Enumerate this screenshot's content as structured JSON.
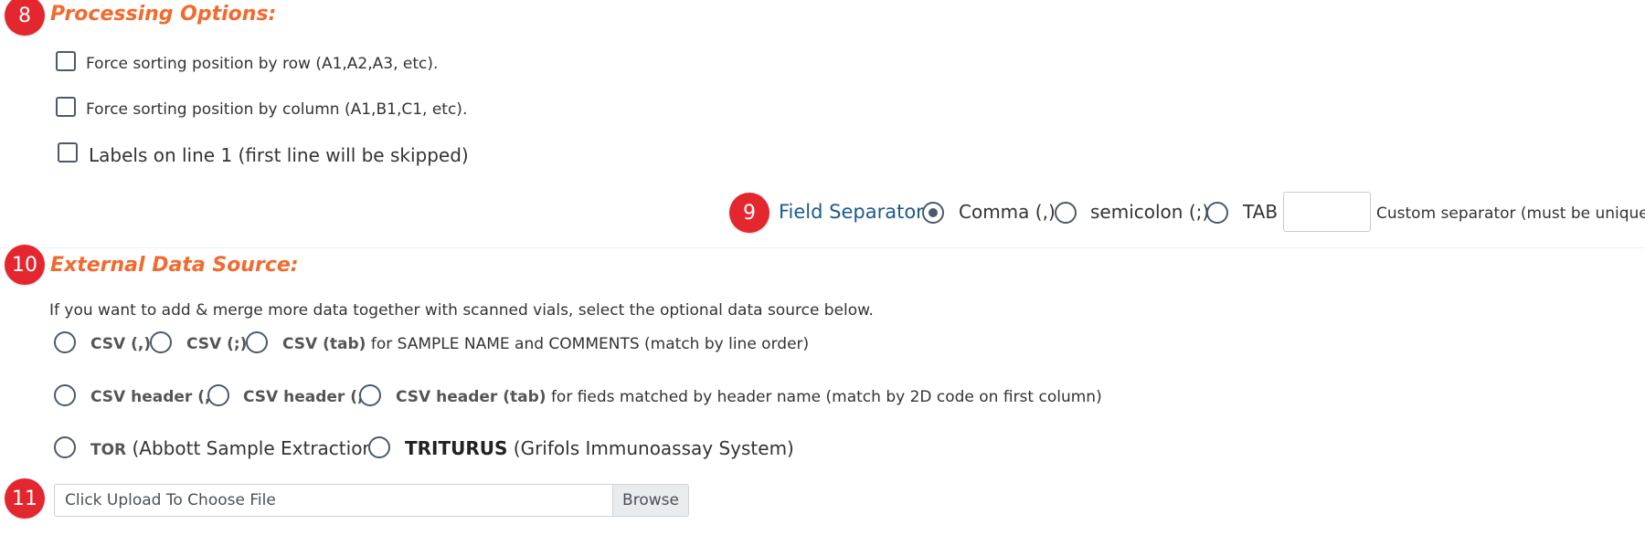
{
  "processing": {
    "badge": "8",
    "title": "Processing Options:",
    "options": [
      "Force sorting position by row (A1,A2,A3, etc).",
      "Force sorting position by column (A1,B1,C1, etc).",
      "Labels on line 1 (first line will be skipped)"
    ]
  },
  "separator": {
    "badge": "9",
    "label": "Field Separator:",
    "options": [
      "Comma (,)",
      "semicolon (;)",
      "TAB"
    ],
    "selected": "Comma (,)",
    "custom_value": "",
    "custom_hint": "Custom separator (must be unique)"
  },
  "external": {
    "badge": "10",
    "title": "External Data Source:",
    "description": "If you want to add & merge more data together with scanned vials, select the optional data source below.",
    "row1": {
      "options": [
        "CSV (,)",
        "CSV (;)",
        "CSV (tab)"
      ],
      "suffix": "for SAMPLE NAME and COMMENTS (match by line order)"
    },
    "row2": {
      "options": [
        "CSV header (,)",
        "CSV header (;)",
        "CSV header (tab)"
      ],
      "suffix": "for fieds matched by header name (match by 2D code on first column)"
    },
    "row3": {
      "tor_name": "TOR",
      "tor_desc": "(Abbott Sample Extraction)",
      "triturus_name": "TRITURUS",
      "triturus_desc": "(Grifols Immunoassay System)"
    }
  },
  "upload": {
    "badge": "11",
    "placeholder": "Click Upload To Choose File",
    "button": "Browse"
  },
  "colors": {
    "badge": "#e4262f",
    "section_title": "#f26a2e",
    "field_label": "#1d5a8a"
  }
}
